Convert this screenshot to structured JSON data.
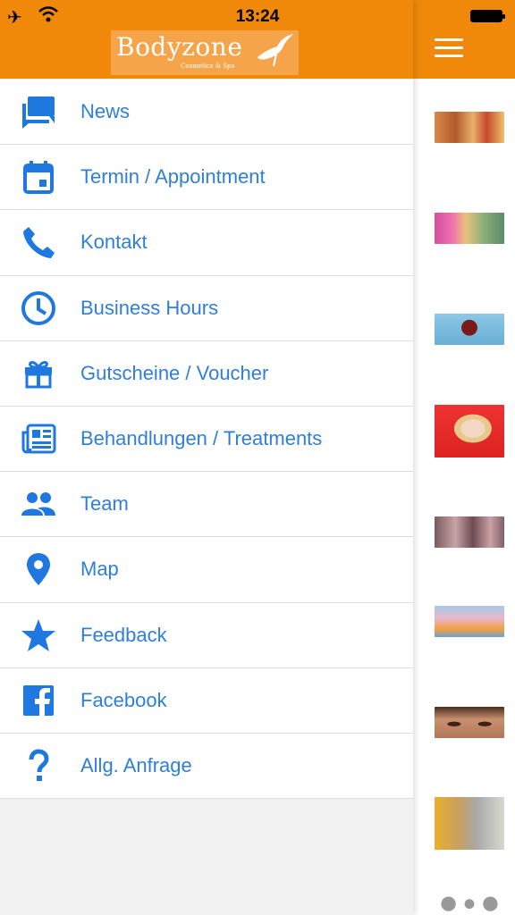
{
  "status_bar": {
    "time": "13:24"
  },
  "colors": {
    "accent": "#f0880a",
    "link": "#2f7fd8",
    "icon": "#1f77e0"
  },
  "app": {
    "logo_text": "Bodyzone",
    "logo_subtitle": "Cosmetics & Spa"
  },
  "menu": {
    "items": [
      {
        "label": "News",
        "icon": "chat-bubbles-icon"
      },
      {
        "label": "Termin / Appointment",
        "icon": "calendar-icon"
      },
      {
        "label": "Kontakt",
        "icon": "phone-icon"
      },
      {
        "label": "Business Hours",
        "icon": "clock-icon"
      },
      {
        "label": "Gutscheine / Voucher",
        "icon": "gift-icon"
      },
      {
        "label": "Behandlungen / Treatments",
        "icon": "newspaper-icon"
      },
      {
        "label": "Team",
        "icon": "people-icon"
      },
      {
        "label": "Map",
        "icon": "map-pin-icon"
      },
      {
        "label": "Feedback",
        "icon": "star-icon"
      },
      {
        "label": "Facebook",
        "icon": "facebook-icon"
      },
      {
        "label": "Allg. Anfrage",
        "icon": "question-icon"
      }
    ]
  },
  "thumbnails": [
    {
      "name": "food-thumbnail"
    },
    {
      "name": "flowers-thumbnail"
    },
    {
      "name": "woman-blue-thumbnail"
    },
    {
      "name": "woman-red-thumbnail"
    },
    {
      "name": "hands-thumbnail"
    },
    {
      "name": "blossom-thumbnail"
    },
    {
      "name": "eyes-thumbnail"
    },
    {
      "name": "salon-thumbnail"
    },
    {
      "name": "faces-thumbnail"
    }
  ]
}
